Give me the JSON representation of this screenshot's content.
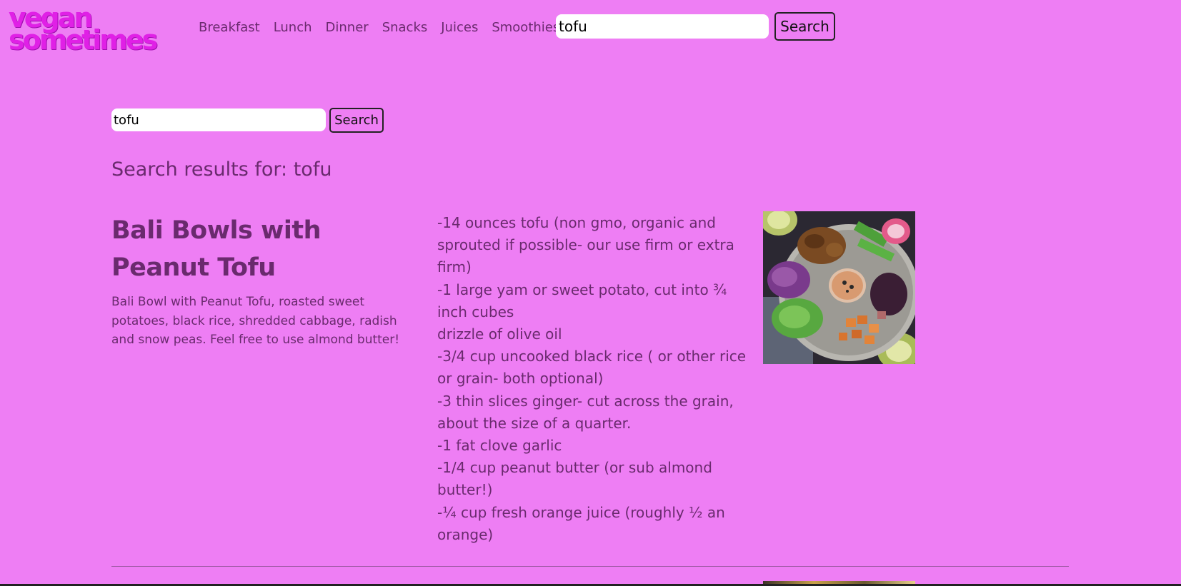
{
  "header": {
    "logo_line1": "vegan",
    "logo_line2": "sometimes",
    "nav": [
      "Breakfast",
      "Lunch",
      "Dinner",
      "Snacks",
      "Juices",
      "Smoothies"
    ],
    "search_value": "tofu",
    "search_button": "Search"
  },
  "main": {
    "search_value": "tofu",
    "search_button": "Search",
    "results_heading": "Search results for: tofu",
    "results": [
      {
        "title": "Bali Bowls with Peanut Tofu",
        "description": "Bali Bowl with Peanut Tofu, roasted sweet potatoes, black rice, shredded cabbage, radish and snow peas. Feel free to use almond butter!",
        "ingredients": [
          "-14 ounces tofu (non gmo, organic and sprouted if possible- our use firm or extra firm)",
          "-1 large yam or sweet potato, cut into ¾ inch cubes",
          "drizzle of olive oil",
          "-3/4 cup uncooked black rice ( or other rice or grain- both optional)",
          "-3 thin slices ginger- cut across the grain, about the size of a quarter.",
          "-1 fat clove garlic",
          "-1/4 cup peanut butter (or sub almond butter!)",
          "-¼ cup fresh orange juice (roughly ½ an orange)"
        ]
      }
    ]
  },
  "colors": {
    "background": "#ee7ef4",
    "text": "#6a2a6e",
    "logo": "#e020e6"
  }
}
